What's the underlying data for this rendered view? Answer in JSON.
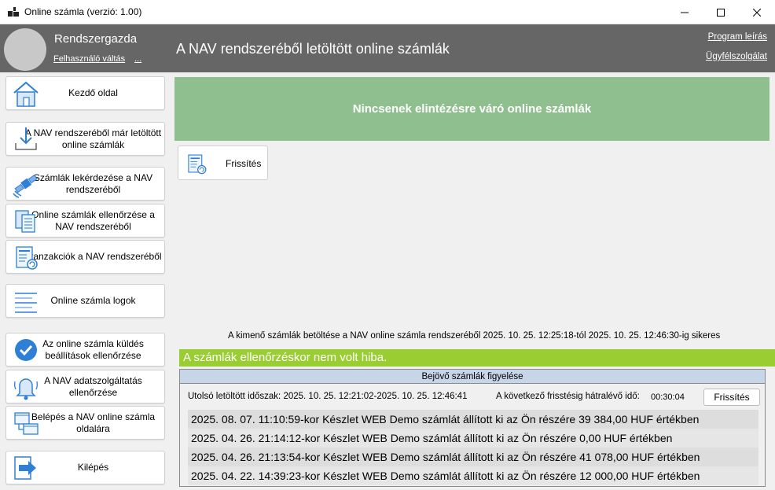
{
  "window": {
    "title": "Online számla (verzió: 1.00)"
  },
  "header": {
    "user_name": "Rendszergazda",
    "switch_user": "Felhasználó váltás",
    "more": "...",
    "title": "A NAV rendszeréből letöltött online számlák",
    "help_link": "Program leírás",
    "support_link": "Ügyfélszolgálat"
  },
  "sidebar": {
    "items": [
      {
        "label": "Kezdő oldal",
        "icon": "home-icon"
      },
      {
        "label": "A NAV rendszeréből már letöltött online számlák",
        "icon": "download-icon"
      },
      {
        "label": "Számlák lekérdezése a NAV rendszeréből",
        "icon": "satellite-icon"
      },
      {
        "label": "Online számlák ellenőrzése a NAV rendszeréből",
        "icon": "documents-icon"
      },
      {
        "label": "Tranzakciók a NAV rendszeréből",
        "icon": "transactions-icon"
      },
      {
        "label": "Online számla logok",
        "icon": "log-list-icon"
      },
      {
        "label": "Az online számla küldés beállítások ellenőrzése",
        "icon": "check-circle-icon"
      },
      {
        "label": "A NAV adatszolgáltatás ellenőrzése",
        "icon": "bell-icon"
      },
      {
        "label": "Belépés a NAV online számla oldalára",
        "icon": "windows-link-icon"
      },
      {
        "label": "Kilépés",
        "icon": "exit-arrow-icon"
      }
    ]
  },
  "main": {
    "banner": "Nincsenek elintézésre váró online számlák",
    "refresh_label": "Frissítés",
    "status_line": "A kimenő számlák betöltése a NAV online számla rendszeréből 2025. 10. 25. 12:25:18-tól 2025. 10. 25. 12:46:30-ig sikeres",
    "ok_message": "A számlák ellenőrzéskor nem volt hiba.",
    "monitor": {
      "title": "Bejövő számlák figyelése",
      "period": "Utolsó letöltött időszak: 2025. 10. 25. 12:21:02-2025. 10. 25. 12:46:41",
      "next_label": "A következő frisstésig hátralévő idő:",
      "next_value": "00:30:04",
      "refresh_label": "Frissítés",
      "items": [
        "2025. 08. 07. 11:10:59-kor Készlet WEB Demo számlát állított ki az Ön részére 39 384,00 HUF értékben",
        "2025. 04. 26. 21:14:12-kor Készlet WEB Demo számlát állított ki az Ön részére 0,00 HUF értékben",
        "2025. 04. 26. 21:13:54-kor Készlet WEB Demo számlát állított ki az Ön részére 41 078,00 HUF értékben",
        "2025. 04. 22. 14:39:23-kor Készlet WEB Demo számlát állított ki az Ön részére 12 000,00 HUF értékben"
      ]
    }
  },
  "colors": {
    "header_bg": "#666666",
    "banner_bg": "#8fbf8f",
    "ok_bar_bg": "#9acd32",
    "monitor_head_bg": "#c6d5e8",
    "icon_blue": "#2f7fd6"
  }
}
